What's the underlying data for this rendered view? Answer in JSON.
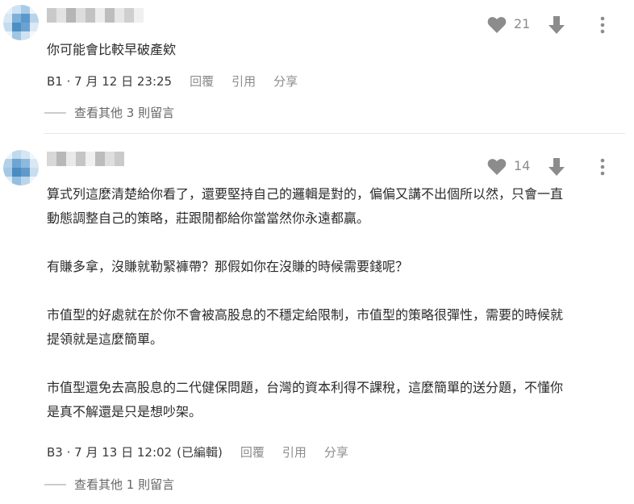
{
  "colors": {
    "icon_gray": "#8c8c8c",
    "text": "#2b2b2b",
    "meta_link": "#8c8c8c",
    "divider": "#e6e6e6",
    "avatar_1": "#9fc6e3",
    "avatar_2": "#4d8fc4"
  },
  "comments": [
    {
      "body": "你可能會比較早破產欸",
      "like_count": "21",
      "floor": "B1",
      "date": "7 月 12 日 23:25",
      "edited": "",
      "reply_label": "回覆",
      "quote_label": "引用",
      "share_label": "分享",
      "more_replies": "查看其他 3 則留言",
      "icons": [
        "heart-icon",
        "downvote-arrow-icon",
        "more-vertical-icon"
      ]
    },
    {
      "body": "算式列這麼清楚給你看了，還要堅持自己的邏輯是對的，偏偏又講不出個所以然，只會一直\n動態調整自己的策略，莊跟閒都給你當當然你永遠都贏。\n\n有賺多拿，沒賺就勒緊褲帶？那假如你在沒賺的時候需要錢呢？\n\n市值型的好處就在於你不會被高股息的不穩定給限制，市值型的策略很彈性，需要的時候就\n提領就是這麼簡單。\n\n市值型還免去高股息的二代健保問題，台灣的資本利得不課稅，這麼簡單的送分題，不懂你\n是真不解還是只是想吵架。",
      "like_count": "14",
      "floor": "B3",
      "date": "7 月 13 日 12:02",
      "edited": "(已編輯)",
      "reply_label": "回覆",
      "quote_label": "引用",
      "share_label": "分享",
      "more_replies": "查看其他 1 則留言",
      "icons": [
        "heart-icon",
        "downvote-arrow-icon",
        "more-vertical-icon"
      ]
    }
  ]
}
